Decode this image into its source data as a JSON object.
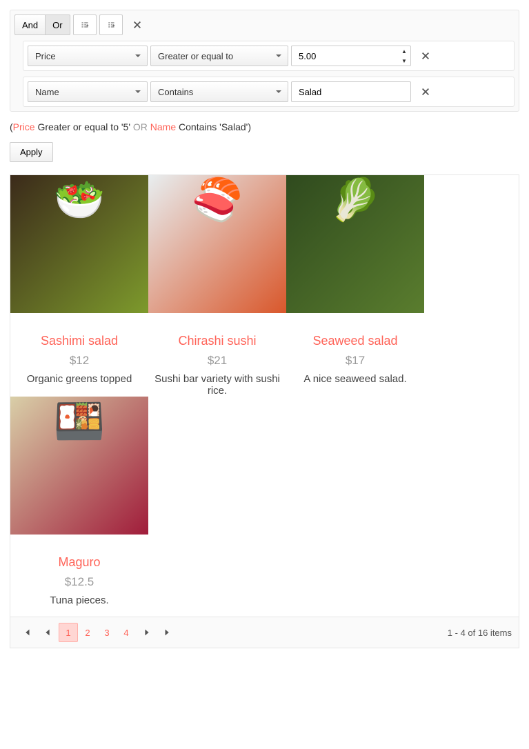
{
  "filter": {
    "and_label": "And",
    "or_label": "Or",
    "active_logic": "Or",
    "rules": [
      {
        "field": "Price",
        "operator": "Greater or equal to",
        "value": "5.00"
      },
      {
        "field": "Name",
        "operator": "Contains",
        "value": "Salad"
      }
    ]
  },
  "expression": {
    "open": "(",
    "f1": "Price",
    "t1": " Greater or equal to '5' ",
    "logic": "OR",
    "space": " ",
    "f2": "Name",
    "t2": " Contains 'Salad')",
    "close": ""
  },
  "apply_label": "Apply",
  "items": [
    {
      "name": "Sashimi salad",
      "price": "$12",
      "desc": "Organic greens topped",
      "bg1": "#3b2a1a",
      "bg2": "#7d9a2c",
      "emoji": "🥗"
    },
    {
      "name": "Chirashi sushi",
      "price": "$21",
      "desc": "Sushi bar variety with sushi rice.",
      "bg1": "#e8eef0",
      "bg2": "#d9572b",
      "emoji": "🍣"
    },
    {
      "name": "Seaweed salad",
      "price": "$17",
      "desc": "A nice seaweed salad.",
      "bg1": "#2f4a1e",
      "bg2": "#5a7d2e",
      "emoji": "🥬"
    },
    {
      "name": "Maguro",
      "price": "$12.5",
      "desc": "Tuna pieces.",
      "bg1": "#d9cfa8",
      "bg2": "#a01c3a",
      "emoji": "🍱"
    }
  ],
  "pager": {
    "pages": [
      "1",
      "2",
      "3",
      "4"
    ],
    "current": "1",
    "info": "1 - 4 of 16 items"
  }
}
